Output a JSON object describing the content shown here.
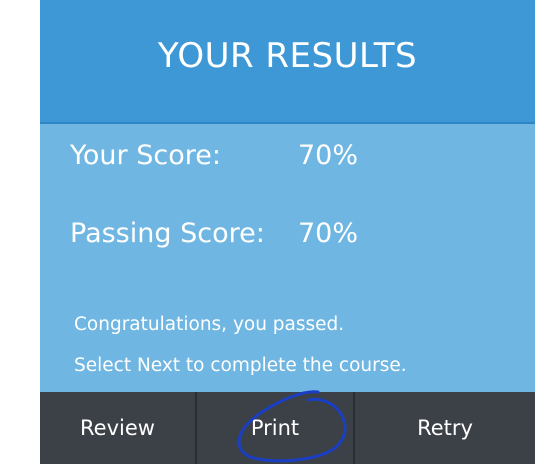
{
  "header": {
    "title": "YOUR RESULTS"
  },
  "results": {
    "your_score_label": "Your Score:",
    "your_score_value": "70%",
    "passing_score_label": "Passing Score:",
    "passing_score_value": "70%"
  },
  "message": {
    "line1": "Congratulations, you passed.",
    "line2": "Select Next to complete the course."
  },
  "buttons": {
    "review": "Review",
    "print": "Print",
    "retry": "Retry"
  },
  "colors": {
    "header_bg": "#3f98d6",
    "panel_bg": "#6fb6e2",
    "button_bar_bg": "#3c4047",
    "annotation_ink": "#1a3fc4"
  }
}
